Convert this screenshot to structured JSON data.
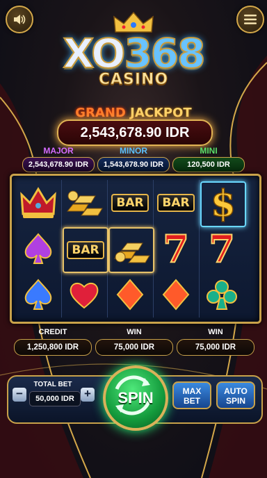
{
  "header": {
    "sound_icon": "speaker-icon",
    "menu_icon": "hamburger-menu-icon"
  },
  "logo": {
    "main_prefix": "XO",
    "main_number": "368",
    "sub": "CASINO"
  },
  "grand_jackpot": {
    "title_word1": "GRAND",
    "title_word2": "JACKPOT",
    "value": "2,543,678.90 IDR"
  },
  "jackpots": [
    {
      "label": "MAJOR",
      "value": "2,543,678.90 IDR",
      "color": "#d46bff"
    },
    {
      "label": "MINOR",
      "value": "1,543,678.90 IDR",
      "color": "#5ac0ff"
    },
    {
      "label": "MINI",
      "value": "120,500 IDR",
      "color": "#5ae06a"
    }
  ],
  "reels": [
    [
      "crown",
      "spade",
      "spade"
    ],
    [
      "gold-bars",
      "bar",
      "heart"
    ],
    [
      "bar",
      "gold-bars",
      "diamond"
    ],
    [
      "bar",
      "seven",
      "diamond"
    ],
    [
      "dollar",
      "seven",
      "club"
    ]
  ],
  "symbol_text": {
    "bar": "BAR",
    "seven": "7",
    "dollar": "$"
  },
  "stats": {
    "credit_label": "CREDIT",
    "credit_value": "1,250,800 IDR",
    "win_label": "WIN",
    "win_value": "75,000 IDR",
    "win2_label": "WIN",
    "win2_value": "75,000 IDR"
  },
  "controls": {
    "total_bet_label": "TOTAL BET",
    "total_bet_value": "50,000 IDR",
    "minus": "−",
    "plus": "+",
    "spin_label": "SPIN",
    "max_bet_line1": "MAX",
    "max_bet_line2": "BET",
    "auto_spin_line1": "AUTO",
    "auto_spin_line2": "SPIN"
  }
}
